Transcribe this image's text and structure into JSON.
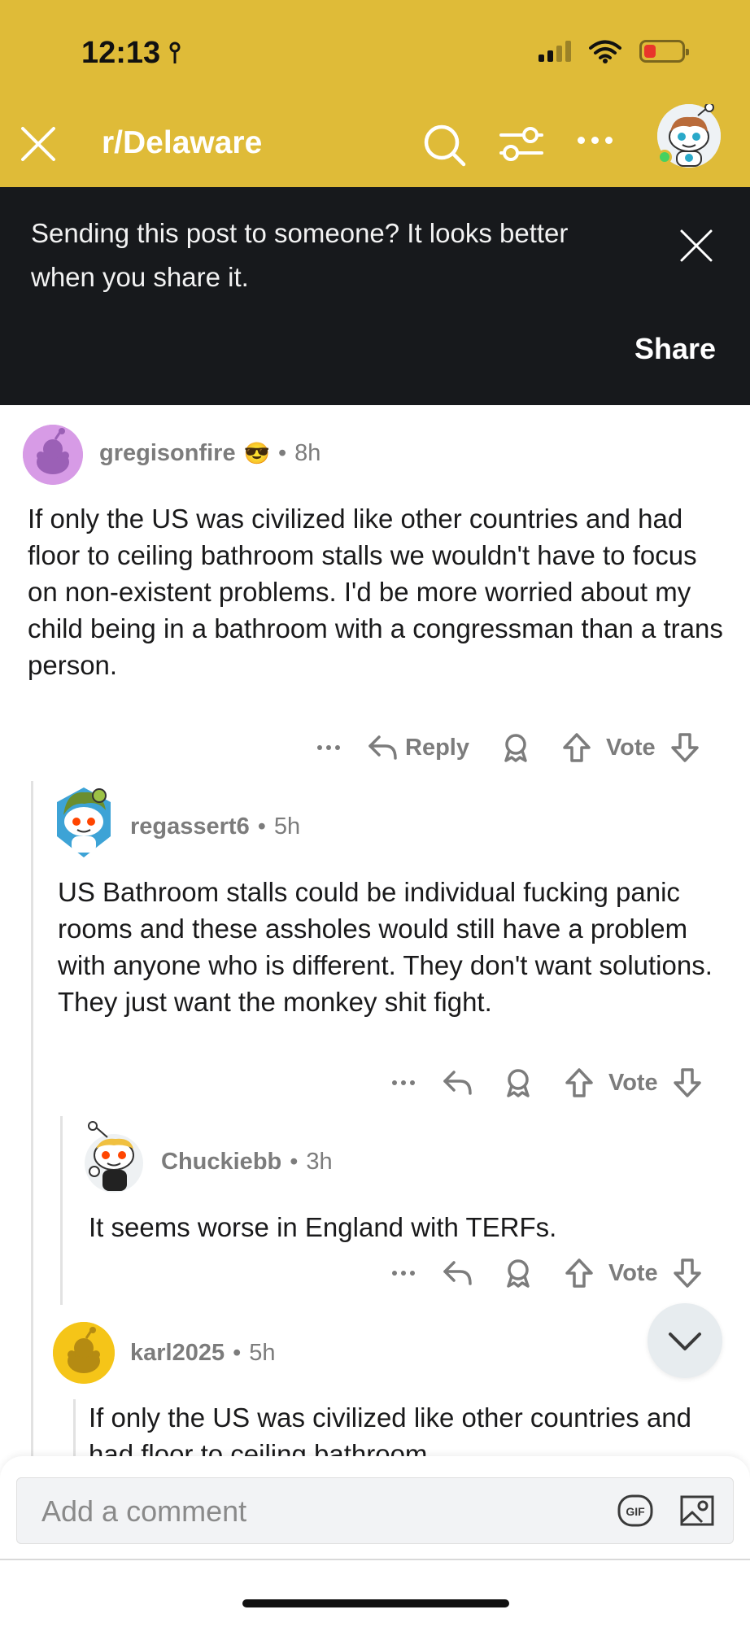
{
  "status_bar": {
    "time": "12:13",
    "battery_color": "#e8352b"
  },
  "nav": {
    "subreddit": "r/Delaware",
    "icons": [
      "close-icon",
      "search-icon",
      "filter-icon",
      "more-icon",
      "avatar"
    ]
  },
  "share_banner": {
    "message": "Sending this post to someone? It looks better when you share it.",
    "button_label": "Share"
  },
  "comments": [
    {
      "username": "gregisonfire",
      "flair": "😎",
      "age": "8h",
      "body": "If only the US was civilized like other countries and had floor to ceiling bathroom stalls we wouldn't have to focus on non-existent problems. I'd be more worried about my child being in a bathroom with a congressman than a trans person.",
      "reply_label": "Reply",
      "vote_label": "Vote"
    },
    {
      "username": "regassert6",
      "age": "5h",
      "body": "US Bathroom stalls could be individual fucking panic rooms and these assholes would still have a problem with anyone who is different.  They don't want solutions. They just want the monkey shit fight.",
      "vote_label": "Vote"
    },
    {
      "username": "Chuckiebb",
      "age": "3h",
      "body": "It seems worse in England with TERFs.",
      "vote_label": "Vote"
    },
    {
      "username": "karl2025",
      "age": "5h",
      "body": "If only the US was civilized like other countries and had floor to ceiling bathroom"
    }
  ],
  "separator": "•",
  "composer": {
    "placeholder": "Add a comment",
    "gif_label": "GIF"
  },
  "colors": {
    "header_yellow": "#dfbb38",
    "banner_dark": "#17191c",
    "meta_grey": "#7c7c7c"
  }
}
